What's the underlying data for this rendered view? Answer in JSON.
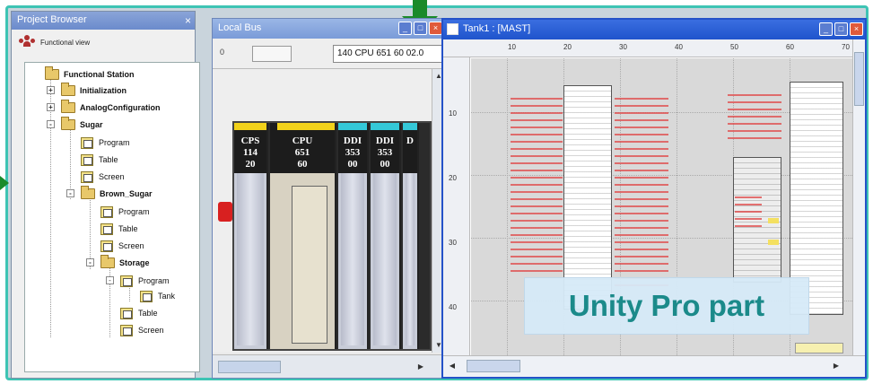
{
  "project_browser": {
    "title": "Project Browser",
    "close_glyph": "×",
    "header_label": "Functional view",
    "tree": [
      {
        "label": "Functional Station",
        "bold": true
      },
      {
        "label": "Initialization",
        "bold": true
      },
      {
        "label": "AnalogConfiguration",
        "bold": true
      },
      {
        "label": "Sugar",
        "bold": true
      },
      {
        "label": "Program",
        "bold": false
      },
      {
        "label": "Table",
        "bold": false
      },
      {
        "label": "Screen",
        "bold": false
      },
      {
        "label": "Brown_Sugar",
        "bold": true
      },
      {
        "label": "Program",
        "bold": false
      },
      {
        "label": "Table",
        "bold": false
      },
      {
        "label": "Screen",
        "bold": false
      },
      {
        "label": "Storage",
        "bold": true
      },
      {
        "label": "Program",
        "bold": false
      },
      {
        "label": "Tank",
        "bold": false
      },
      {
        "label": "Table",
        "bold": false
      },
      {
        "label": "Screen",
        "bold": false
      }
    ]
  },
  "local_bus": {
    "title": "Local Bus",
    "label0": "0",
    "cpu_field": "140 CPU 651 60   02.0",
    "modules": [
      {
        "name": "CPS",
        "line2": "114",
        "line3": "20",
        "color": "#f2d21a"
      },
      {
        "name": "CPU",
        "line2": "651",
        "line3": "60",
        "color": "#f2d21a"
      },
      {
        "name": "DDI",
        "line2": "353",
        "line3": "00",
        "color": "#34c8d8"
      },
      {
        "name": "DDI",
        "line2": "353",
        "line3": "00",
        "color": "#34c8d8"
      },
      {
        "name": "D",
        "line2": "",
        "line3": "",
        "color": "#34c8d8"
      }
    ]
  },
  "task_window": {
    "title": "Tank1 : [MAST]",
    "ruler_top": [
      "10",
      "20",
      "30",
      "40",
      "50",
      "60",
      "70"
    ],
    "ruler_left": [
      "10",
      "20",
      "30",
      "40"
    ]
  },
  "banner": {
    "text": "Unity Pro part"
  },
  "colors": {
    "frame": "#3ec4b4",
    "arrow": "#1a8a2a",
    "banner_text": "#1b8a8a",
    "title_bar": "#1f54cc"
  }
}
